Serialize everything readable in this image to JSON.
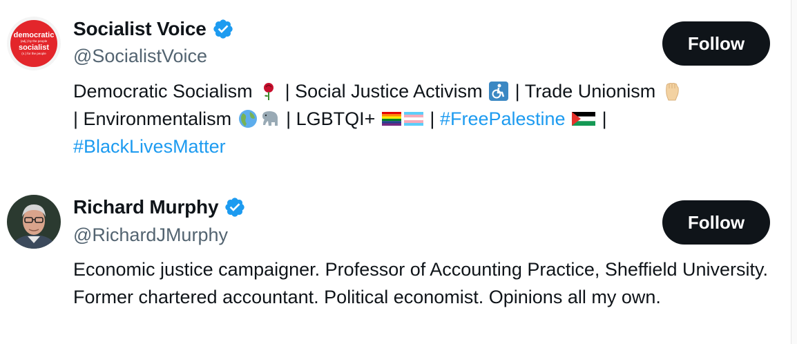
{
  "accounts": [
    {
      "name": "Socialist Voice",
      "handle": "@SocialistVoice",
      "follow_label": "Follow",
      "avatar_text": {
        "line1": "democratic",
        "line2": "(adj.) by the people",
        "line3": "socialist",
        "line4": "(n.) for the people"
      },
      "bio": {
        "p1": "Democratic Socialism ",
        "p2": " | Social Justice Activism ",
        "p3": " | Trade Unionism ",
        "p4": "| Environmentalism ",
        "p5": " | LGBTQI+ ",
        "p6": " | ",
        "tag1": "#FreePalestine",
        "p7": " | ",
        "tag2": "#BlackLivesMatter"
      }
    },
    {
      "name": "Richard Murphy",
      "handle": "@RichardJMurphy",
      "follow_label": "Follow",
      "bio": "Economic justice campaigner. Professor of Accounting Practice, Sheffield University. Former chartered accountant. Political economist. Opinions all my own."
    }
  ],
  "colors": {
    "text": "#0f1419",
    "muted": "#536471",
    "link": "#1d9bf0",
    "verified": "#1d9bf0",
    "button_bg": "#0f1419",
    "avatar_red": "#e3262b"
  },
  "icons": [
    "verified-badge-icon",
    "rose-icon",
    "wheelchair-icon",
    "raised-fist-icon",
    "globe-icon",
    "elephant-icon",
    "rainbow-flag-icon",
    "trans-flag-icon",
    "palestine-flag-icon"
  ]
}
